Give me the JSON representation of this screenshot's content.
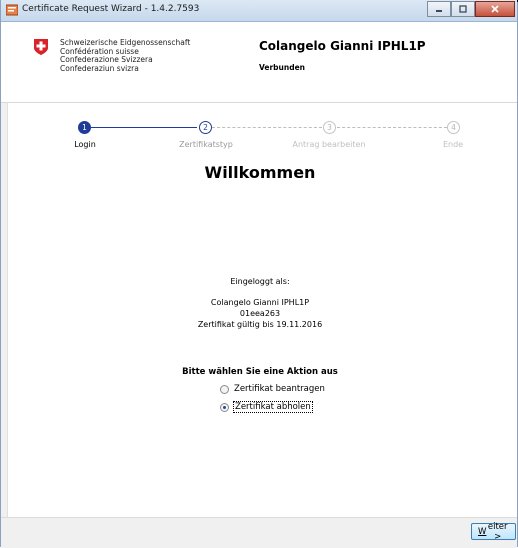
{
  "window": {
    "title": "Certificate Request Wizard - 1.4.2.7593"
  },
  "header": {
    "confederation": [
      "Schweizerische Eidgenossenschaft",
      "Confédération suisse",
      "Confederazione Svizzera",
      "Confederaziun svizra"
    ],
    "user_name": "Colangelo Gianni IPHL1P",
    "connection_status": "Verbunden"
  },
  "steps": [
    {
      "number": "1",
      "label": "Login",
      "state": "done"
    },
    {
      "number": "2",
      "label": "Zertifikatstyp",
      "state": "current"
    },
    {
      "number": "3",
      "label": "Antrag bearbeiten",
      "state": "pending"
    },
    {
      "number": "4",
      "label": "Ende",
      "state": "pending"
    }
  ],
  "main": {
    "title": "Willkommen",
    "logged_in_label": "Eingeloggt als:",
    "user_name": "Colangelo Gianni IPHL1P",
    "user_id": "01eea263",
    "cert_valid": "Zertifikat gültig bis 19.11.2016",
    "action_title": "Bitte wählen Sie eine Aktion aus",
    "options": [
      {
        "label": "Zertifikat beantragen",
        "selected": false
      },
      {
        "label": "Zertifikat abholen",
        "selected": true
      }
    ]
  },
  "footer": {
    "next_label": "Weiter >"
  }
}
